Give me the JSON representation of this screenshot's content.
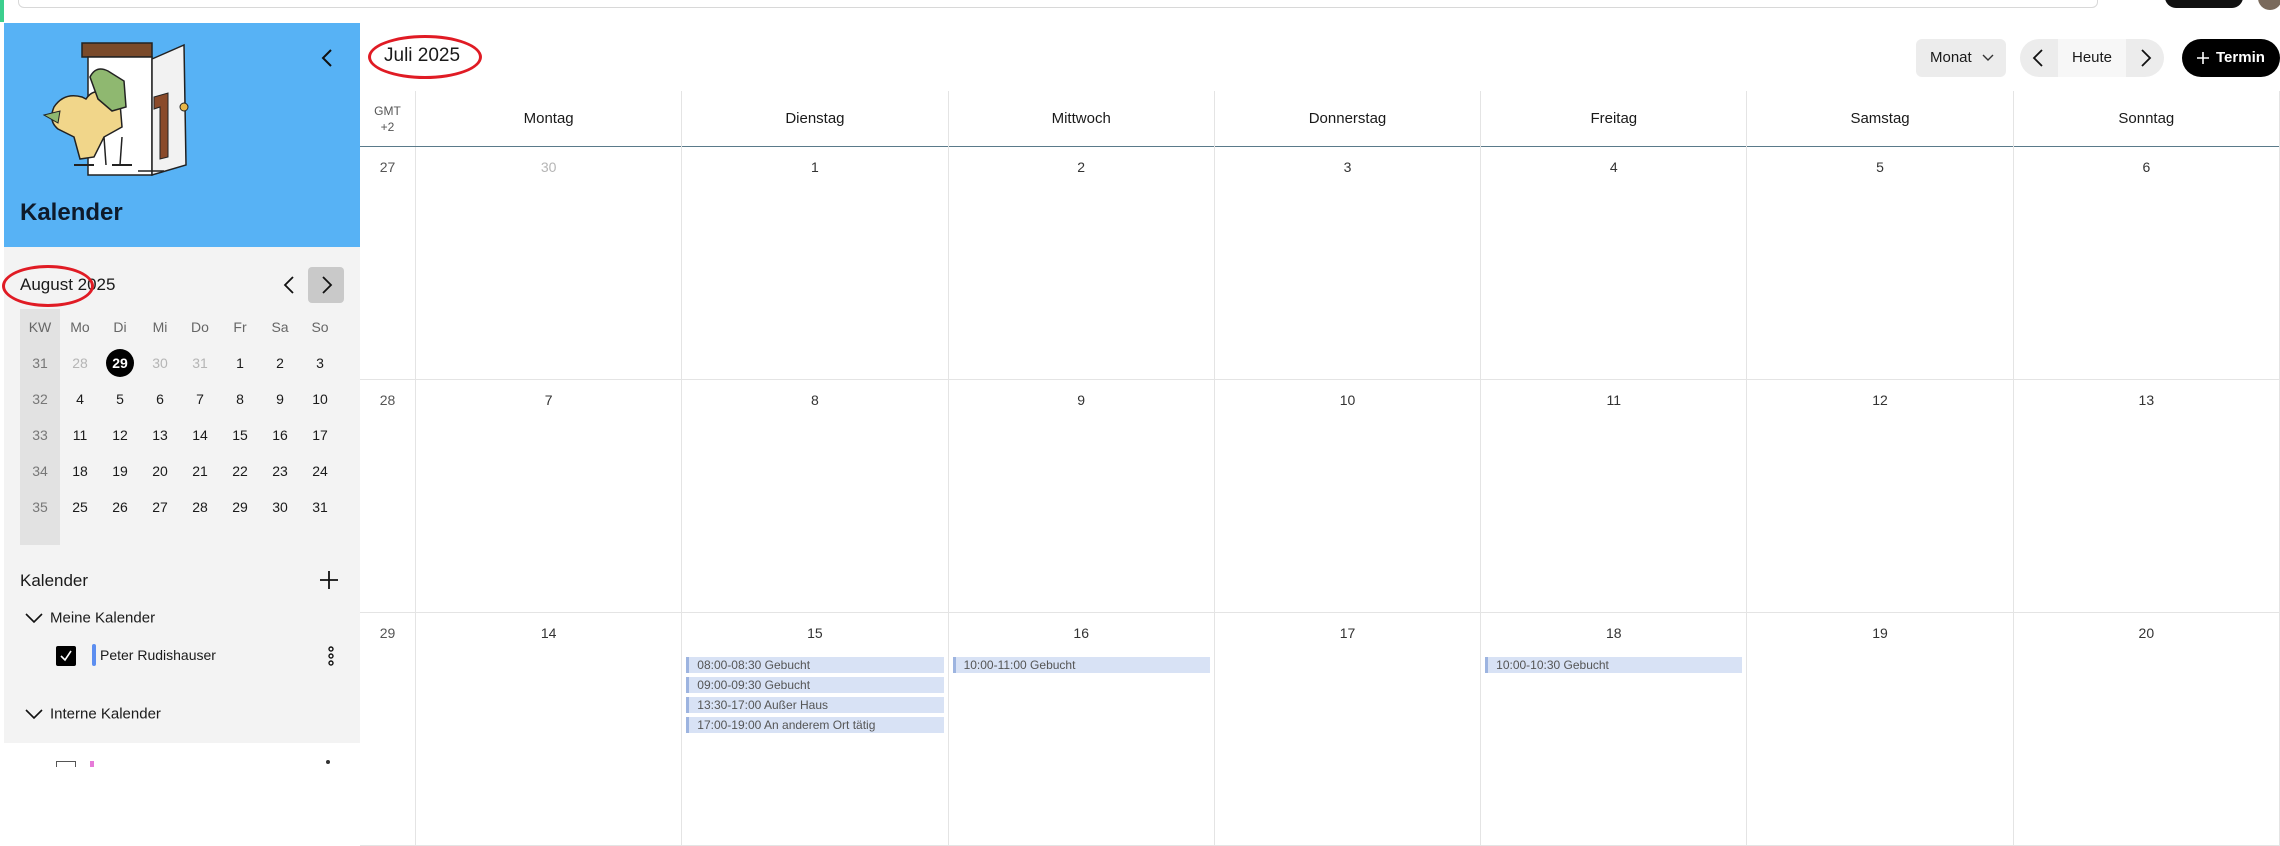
{
  "sidebar": {
    "banner_title": "Kalender",
    "mini": {
      "title": "August 2025",
      "headers": [
        "KW",
        "Mo",
        "Di",
        "Mi",
        "Do",
        "Fr",
        "Sa",
        "So"
      ],
      "weeks": [
        {
          "kw": "31",
          "days": [
            {
              "d": "28",
              "o": true
            },
            {
              "d": "29",
              "t": true
            },
            {
              "d": "30",
              "o": true
            },
            {
              "d": "31",
              "o": true
            },
            {
              "d": "1"
            },
            {
              "d": "2"
            },
            {
              "d": "3"
            }
          ]
        },
        {
          "kw": "32",
          "days": [
            {
              "d": "4"
            },
            {
              "d": "5"
            },
            {
              "d": "6"
            },
            {
              "d": "7"
            },
            {
              "d": "8"
            },
            {
              "d": "9"
            },
            {
              "d": "10"
            }
          ]
        },
        {
          "kw": "33",
          "days": [
            {
              "d": "11"
            },
            {
              "d": "12"
            },
            {
              "d": "13"
            },
            {
              "d": "14"
            },
            {
              "d": "15"
            },
            {
              "d": "16"
            },
            {
              "d": "17"
            }
          ]
        },
        {
          "kw": "34",
          "days": [
            {
              "d": "18"
            },
            {
              "d": "19"
            },
            {
              "d": "20"
            },
            {
              "d": "21"
            },
            {
              "d": "22"
            },
            {
              "d": "23"
            },
            {
              "d": "24"
            }
          ]
        },
        {
          "kw": "35",
          "days": [
            {
              "d": "25"
            },
            {
              "d": "26"
            },
            {
              "d": "27"
            },
            {
              "d": "28"
            },
            {
              "d": "29"
            },
            {
              "d": "30"
            },
            {
              "d": "31"
            }
          ]
        }
      ]
    },
    "calendars_title": "Kalender",
    "my_calendars_label": "Meine Kalender",
    "my_calendar_name": "Peter Rudishauser",
    "internal_calendars_label": "Interne Kalender",
    "calendar_color": "#5c8ef0"
  },
  "main": {
    "title": "Juli 2025",
    "view_label": "Monat",
    "today_label": "Heute",
    "new_label": "Termin",
    "tz_line1": "GMT",
    "tz_line2": "+2",
    "day_headers": [
      "Montag",
      "Dienstag",
      "Mittwoch",
      "Donnerstag",
      "Freitag",
      "Samstag",
      "Sonntag"
    ],
    "weeks": [
      {
        "kw": "27",
        "days": [
          {
            "d": "30",
            "o": true
          },
          {
            "d": "1"
          },
          {
            "d": "2"
          },
          {
            "d": "3"
          },
          {
            "d": "4"
          },
          {
            "d": "5"
          },
          {
            "d": "6"
          }
        ]
      },
      {
        "kw": "28",
        "days": [
          {
            "d": "7"
          },
          {
            "d": "8"
          },
          {
            "d": "9"
          },
          {
            "d": "10"
          },
          {
            "d": "11"
          },
          {
            "d": "12"
          },
          {
            "d": "13"
          }
        ]
      },
      {
        "kw": "29",
        "days": [
          {
            "d": "14"
          },
          {
            "d": "15",
            "events": [
              "08:00-08:30  Gebucht",
              "09:00-09:30  Gebucht",
              "13:30-17:00  Außer Haus",
              "17:00-19:00  An anderem Ort tätig"
            ]
          },
          {
            "d": "16",
            "events": [
              "10:00-11:00  Gebucht"
            ]
          },
          {
            "d": "17"
          },
          {
            "d": "18",
            "events": [
              "10:00-10:30  Gebucht"
            ]
          },
          {
            "d": "19"
          },
          {
            "d": "20"
          }
        ]
      }
    ],
    "event_color": "#d8e2f5",
    "accent_color": "#e01b24"
  }
}
